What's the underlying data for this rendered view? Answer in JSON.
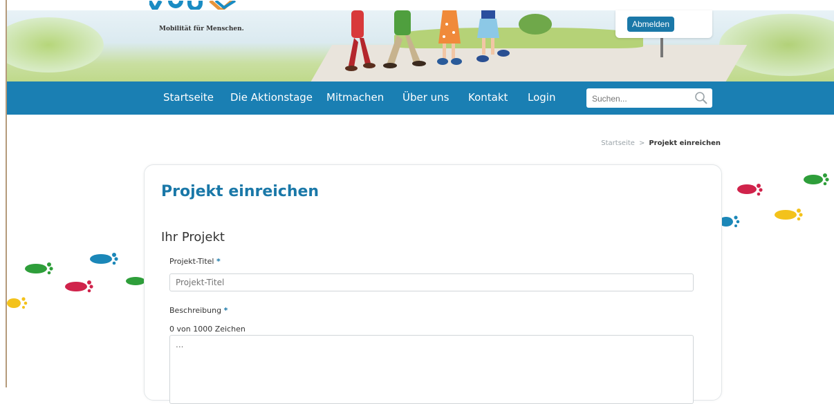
{
  "brand": {
    "logo_text": "VGB",
    "tagline": "Mobilität für Menschen."
  },
  "user_menu": {
    "logout_label": "Abmelden"
  },
  "nav": {
    "items": [
      {
        "label": "Startseite"
      },
      {
        "label": "Die Aktionstage"
      },
      {
        "label": "Mitmachen"
      },
      {
        "label": "Über uns"
      },
      {
        "label": "Kontakt"
      },
      {
        "label": "Login"
      }
    ],
    "search_placeholder": "Suchen..."
  },
  "breadcrumb": {
    "home": "Startseite",
    "separator": ">",
    "current": "Projekt einreichen"
  },
  "form": {
    "page_title": "Projekt einreichen",
    "section_title": "Ihr Projekt",
    "title_label": "Projekt-Titel",
    "title_placeholder": "Projekt-Titel",
    "required_mark": "*",
    "description_label": "Beschreibung",
    "char_count": "0 von 1000 Zeichen",
    "description_placeholder": "..."
  },
  "colors": {
    "primary": "#1a7fb3",
    "accent": "#1a78a8",
    "footprint_green": "#2e9e3a",
    "footprint_red": "#d0234b",
    "footprint_blue": "#1b87b8",
    "footprint_yellow": "#f3c21b"
  },
  "icons": {
    "search": "search-icon",
    "footprints": "footprint-icon"
  }
}
